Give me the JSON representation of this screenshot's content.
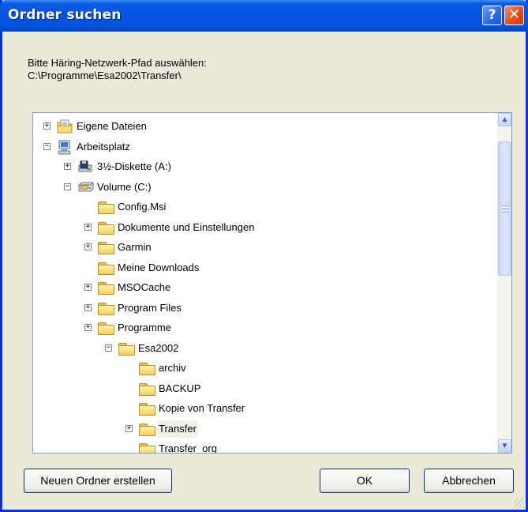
{
  "window": {
    "title": "Ordner suchen",
    "help_label": "?",
    "close_label": "✕"
  },
  "prompt": {
    "line1": "Bitte Häring-Netzwerk-Pfad auswählen:",
    "line2": "C:\\Programme\\Esa2002\\Transfer\\"
  },
  "tree": {
    "nodes": [
      {
        "label": "Eigene Dateien",
        "icon": "my-documents-icon",
        "expander": "+",
        "level": 0
      },
      {
        "label": "Arbeitsplatz",
        "icon": "my-computer-icon",
        "expander": "−",
        "level": 0
      },
      {
        "label": "3½-Diskette (A:)",
        "icon": "floppy-drive-icon",
        "expander": "+",
        "level": 1
      },
      {
        "label": "Volume (C:)",
        "icon": "hard-drive-icon",
        "expander": "−",
        "level": 1
      },
      {
        "label": "Config.Msi",
        "icon": "folder-icon",
        "expander": "",
        "level": 2
      },
      {
        "label": "Dokumente und Einstellungen",
        "icon": "folder-icon",
        "expander": "+",
        "level": 2
      },
      {
        "label": "Garmin",
        "icon": "folder-icon",
        "expander": "+",
        "level": 2
      },
      {
        "label": "Meine Downloads",
        "icon": "folder-icon",
        "expander": "",
        "level": 2
      },
      {
        "label": "MSOCache",
        "icon": "folder-icon",
        "expander": "+",
        "level": 2
      },
      {
        "label": "Program Files",
        "icon": "folder-icon",
        "expander": "+",
        "level": 2
      },
      {
        "label": "Programme",
        "icon": "folder-icon",
        "expander": "+",
        "level": 2
      },
      {
        "label": "Esa2002",
        "icon": "folder-icon",
        "expander": "−",
        "level": 3
      },
      {
        "label": "archiv",
        "icon": "folder-icon",
        "expander": "",
        "level": 4
      },
      {
        "label": "BACKUP",
        "icon": "folder-icon",
        "expander": "",
        "level": 4
      },
      {
        "label": "Kopie von Transfer",
        "icon": "folder-icon",
        "expander": "",
        "level": 4
      },
      {
        "label": "Transfer",
        "icon": "folder-icon",
        "expander": "+",
        "level": 4,
        "selected": true
      },
      {
        "label": "Transfer_org",
        "icon": "folder-icon",
        "expander": "",
        "level": 4
      }
    ]
  },
  "scrollbar": {
    "up_icon": "scroll-up-arrow-icon",
    "down_icon": "scroll-down-arrow-icon",
    "up_glyph": "▲",
    "down_glyph": "▼"
  },
  "buttons": {
    "new_folder": "Neuen Ordner erstellen",
    "ok": "OK",
    "cancel": "Abbrechen"
  },
  "colors": {
    "title_blue": "#0553e3",
    "frame_blue": "#0831d9",
    "dialog_bg": "#ece9d8",
    "close_red": "#e2501f"
  }
}
